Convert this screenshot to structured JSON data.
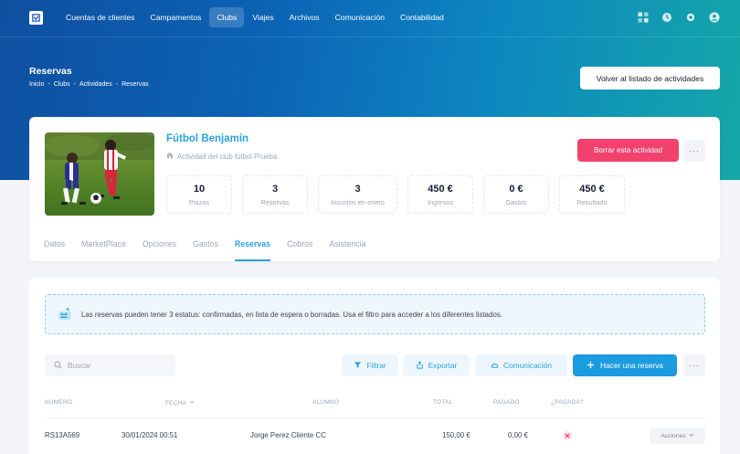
{
  "nav": {
    "items": [
      "Cuentas de clientes",
      "Campamentos",
      "Clubs",
      "Viajes",
      "Archivos",
      "Comunicación",
      "Contabilidad"
    ],
    "active_index": 2
  },
  "header": {
    "title": "Reservas",
    "breadcrumb": [
      "Inicio",
      "-",
      "Clubs",
      "-",
      "Actividades",
      "-",
      "Reservas"
    ],
    "back_button": "Volver al listado de actividades"
  },
  "activity": {
    "title": "Fútbol Benjamín",
    "subtitle": "Actividad del club fútbol Prueba",
    "delete_button": "Borrar esta actividad",
    "more_label": "···",
    "stats": [
      {
        "value": "10",
        "label": "Plazas"
      },
      {
        "value": "3",
        "label": "Reservas"
      },
      {
        "value": "3",
        "label": "Inscritos en enero"
      },
      {
        "value": "450 €",
        "label": "Ingresos"
      },
      {
        "value": "0 €",
        "label": "Gastos"
      },
      {
        "value": "450 €",
        "label": "Resultado"
      }
    ],
    "tabs": [
      "Datos",
      "MarketPlace",
      "Opciones",
      "Gastos",
      "Reservas",
      "Cobros",
      "Asistencia"
    ],
    "active_tab": 4
  },
  "reservations": {
    "notice": "Las reservas pueden tener 3 estatus: confirmadas, en lista de espera o borradas. Usa el filtro para acceder a los diferentes listados.",
    "search_placeholder": "Buscar",
    "toolbar": {
      "filter": "Filtrar",
      "export": "Exportar",
      "communication": "Comunicación",
      "new_reservation": "Hacer una reserva",
      "more": "···"
    },
    "columns": {
      "number": "Número",
      "date": "Fecha",
      "student": "Alumno",
      "total": "Total",
      "paid": "Pagado",
      "is_paid": "¿Pagada?"
    },
    "rows": [
      {
        "number": "RS13A569",
        "date": "30/01/2024 00:51",
        "student": "Jorge Perez Cliente CC",
        "total": "150,00 €",
        "paid": "0,00 €",
        "is_paid": false,
        "actions": "Acciones"
      }
    ]
  },
  "colors": {
    "accent": "#2aa3e0",
    "primary_button": "#1b9be0",
    "danger": "#f1416c"
  }
}
